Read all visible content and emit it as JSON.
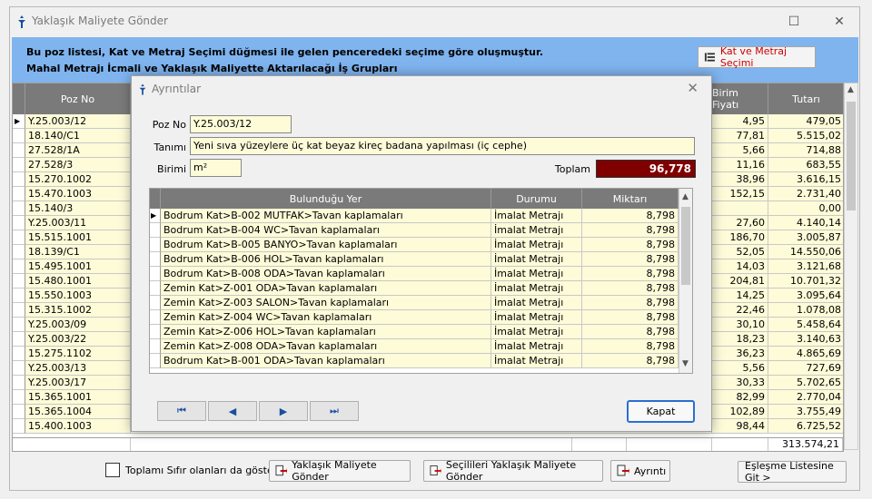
{
  "window": {
    "title": "Yaklaşık Maliyete Gönder"
  },
  "banner": {
    "line1": "Bu poz listesi, Kat ve Metraj Seçimi düğmesi ile gelen penceredeki seçime göre oluşmuştur.",
    "line2": "Mahal Metrajı İcmali ve Yaklaşık Maliyette Aktarılacağı İş Grupları",
    "kvm_button": "Kat ve Metraj Seçimi"
  },
  "grid": {
    "headers": {
      "poz_no": "Poz No",
      "birim_fiyati": "Birim Fiyatı",
      "tutari": "Tutarı"
    },
    "rows": [
      {
        "poz": "Y.25.003/12",
        "bf": "4,95",
        "tutar": "479,05"
      },
      {
        "poz": "18.140/C1",
        "bf": "77,81",
        "tutar": "5.515,02"
      },
      {
        "poz": "27.528/1A",
        "bf": "5,66",
        "tutar": "714,88"
      },
      {
        "poz": "27.528/3",
        "bf": "11,16",
        "tutar": "683,55"
      },
      {
        "poz": "15.270.1002",
        "bf": "38,96",
        "tutar": "3.616,15"
      },
      {
        "poz": "15.470.1003",
        "bf": "152,15",
        "tutar": "2.731,40"
      },
      {
        "poz": "15.140/3",
        "bf": "",
        "tutar": "0,00"
      },
      {
        "poz": "Y.25.003/11",
        "bf": "27,60",
        "tutar": "4.140,14"
      },
      {
        "poz": "15.515.1001",
        "bf": "186,70",
        "tutar": "3.005,87"
      },
      {
        "poz": "18.139/C1",
        "bf": "52,05",
        "tutar": "14.550,06"
      },
      {
        "poz": "15.495.1001",
        "bf": "14,03",
        "tutar": "3.121,68"
      },
      {
        "poz": "15.480.1001",
        "bf": "204,81",
        "tutar": "10.701,32"
      },
      {
        "poz": "15.550.1003",
        "bf": "14,25",
        "tutar": "3.095,64"
      },
      {
        "poz": "15.315.1002",
        "bf": "22,46",
        "tutar": "1.078,08"
      },
      {
        "poz": "Y.25.003/09",
        "bf": "30,10",
        "tutar": "5.458,64"
      },
      {
        "poz": "Y.25.003/22",
        "bf": "18,23",
        "tutar": "3.140,63"
      },
      {
        "poz": "15.275.1102",
        "bf": "36,23",
        "tutar": "4.865,69"
      },
      {
        "poz": "Y.25.003/13",
        "bf": "5,56",
        "tutar": "727,69"
      },
      {
        "poz": "Y.25.003/17",
        "bf": "30,33",
        "tutar": "5.702,65"
      },
      {
        "poz": "15.365.1001",
        "bf": "82,99",
        "tutar": "2.770,04"
      },
      {
        "poz": "15.365.1004",
        "bf": "102,89",
        "tutar": "3.755,49"
      },
      {
        "poz": "15.400.1003",
        "bf": "98,44",
        "tutar": "6.725,52"
      }
    ],
    "total": "313.574,21"
  },
  "bottom": {
    "checkbox_label": "Toplamı Sıfır olanları da göster",
    "send_btn": "Yaklaşık Maliyete Gönder",
    "send_selected_btn": "Seçilileri Yaklaşık Maliyete Gönder",
    "detail_btn": "Ayrıntı",
    "match_btn": "Eşleşme Listesine Git >"
  },
  "dialog": {
    "title": "Ayrıntılar",
    "poz_no_label": "Poz No",
    "poz_no": "Y.25.003/12",
    "tanimi_label": "Tanımı",
    "tanimi": "Yeni sıva yüzeylere üç kat beyaz kireç badana yapılması (iç cephe)",
    "birimi_label": "Birimi",
    "birimi": "m²",
    "toplam_label": "Toplam",
    "toplam": "96,778",
    "headers": {
      "yer": "Bulunduğu Yer",
      "durum": "Durumu",
      "miktar": "Miktarı"
    },
    "rows": [
      {
        "yer": "Bodrum Kat>B-002 MUTFAK>Tavan kaplamaları",
        "durum": "İmalat Metrajı",
        "miktar": "8,798"
      },
      {
        "yer": "Bodrum Kat>B-004 WC>Tavan kaplamaları",
        "durum": "İmalat Metrajı",
        "miktar": "8,798"
      },
      {
        "yer": "Bodrum Kat>B-005 BANYO>Tavan kaplamaları",
        "durum": "İmalat Metrajı",
        "miktar": "8,798"
      },
      {
        "yer": "Bodrum Kat>B-006 HOL>Tavan kaplamaları",
        "durum": "İmalat Metrajı",
        "miktar": "8,798"
      },
      {
        "yer": "Bodrum Kat>B-008 ODA>Tavan kaplamaları",
        "durum": "İmalat Metrajı",
        "miktar": "8,798"
      },
      {
        "yer": "Zemin Kat>Z-001 ODA>Tavan kaplamaları",
        "durum": "İmalat Metrajı",
        "miktar": "8,798"
      },
      {
        "yer": "Zemin Kat>Z-003 SALON>Tavan kaplamaları",
        "durum": "İmalat Metrajı",
        "miktar": "8,798"
      },
      {
        "yer": "Zemin Kat>Z-004 WC>Tavan kaplamaları",
        "durum": "İmalat Metrajı",
        "miktar": "8,798"
      },
      {
        "yer": "Zemin Kat>Z-006 HOL>Tavan kaplamaları",
        "durum": "İmalat Metrajı",
        "miktar": "8,798"
      },
      {
        "yer": "Zemin Kat>Z-008 ODA>Tavan kaplamaları",
        "durum": "İmalat Metrajı",
        "miktar": "8,798"
      },
      {
        "yer": "Bodrum Kat>B-001 ODA>Tavan kaplamaları",
        "durum": "İmalat Metrajı",
        "miktar": "8,798"
      }
    ],
    "close_btn": "Kapat"
  }
}
